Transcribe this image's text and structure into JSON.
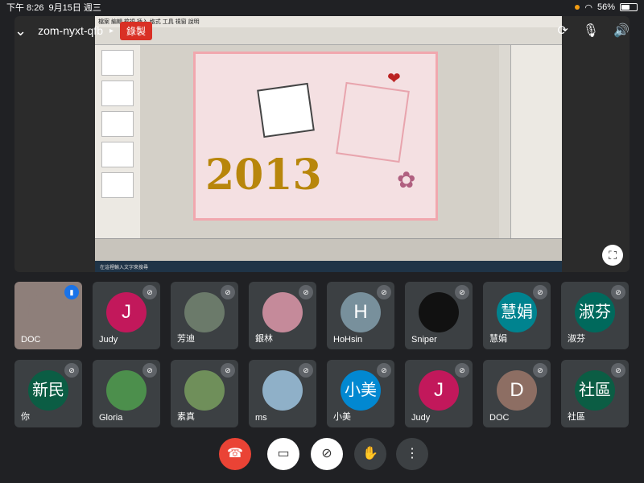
{
  "status": {
    "time": "下午 8:26",
    "date": "9月15日 週三",
    "battery": "56%",
    "battery_level": 0.56
  },
  "meeting": {
    "code": "zom-nyxt-qfb",
    "recording": "錄製"
  },
  "shared_screen": {
    "canvas_text": "2013",
    "taskbar_search": "在這裡輸入文字來搜尋"
  },
  "participants_row1": [
    {
      "name": "DOC",
      "initial": "",
      "bg": "#8e7f7a",
      "speaking": true
    },
    {
      "name": "Judy",
      "initial": "J",
      "bg": "#c2185b"
    },
    {
      "name": "芳迪",
      "initial": "",
      "bg": "#6b7a6a"
    },
    {
      "name": "銀林",
      "initial": "",
      "bg": "#c58a9a"
    },
    {
      "name": "HoHsin",
      "initial": "H",
      "bg": "#78909c"
    },
    {
      "name": "Sniper",
      "initial": "",
      "bg": "#111111"
    },
    {
      "name": "慧娟",
      "initial": "慧娟",
      "bg": "#00838f"
    },
    {
      "name": "淑芬",
      "initial": "淑芬",
      "bg": "#00695c"
    }
  ],
  "participants_row2": [
    {
      "name": "你",
      "initial": "新民",
      "bg": "#0b5d44"
    },
    {
      "name": "Gloria",
      "initial": "",
      "bg": "#4c8f4c"
    },
    {
      "name": "素真",
      "initial": "",
      "bg": "#6f8f5a"
    },
    {
      "name": "ms",
      "initial": "",
      "bg": "#8fb0c8"
    },
    {
      "name": "小美",
      "initial": "小美",
      "bg": "#0288d1"
    },
    {
      "name": "Judy",
      "initial": "J",
      "bg": "#c2185b"
    },
    {
      "name": "DOC",
      "initial": "D",
      "bg": "#8d6e63"
    },
    {
      "name": "社區",
      "initial": "社區",
      "bg": "#0b5d44"
    }
  ]
}
